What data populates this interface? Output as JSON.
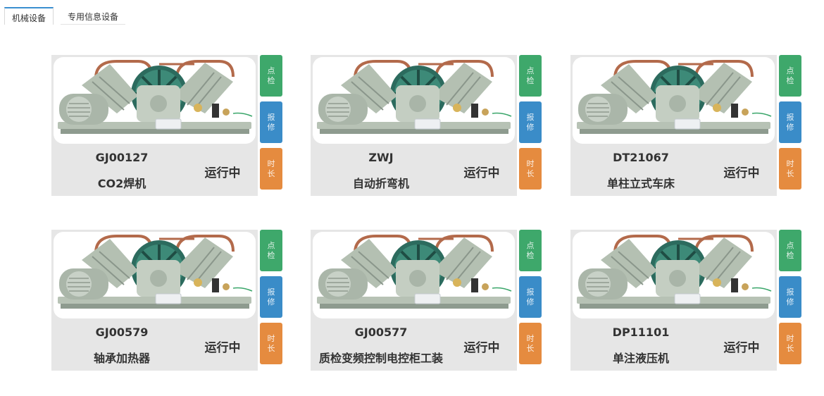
{
  "tabs": [
    {
      "label": "机械设备",
      "active": true
    },
    {
      "label": "专用信息设备",
      "active": false
    }
  ],
  "colors": {
    "inspect": "#3ea86b",
    "repair": "#3a8cc8",
    "duration": "#e58b3f",
    "card_bg": "#e6e6e6"
  },
  "side_buttons": {
    "inspect": "点检",
    "repair": "报修",
    "duration": "时长"
  },
  "devices": [
    {
      "code": "GJ00127",
      "name": "CO2焊机",
      "status": "运行中",
      "image_icon": "compressor-photo"
    },
    {
      "code": "ZWJ",
      "name": "自动折弯机",
      "status": "运行中",
      "image_icon": "compressor-photo"
    },
    {
      "code": "DT21067",
      "name": "单柱立式车床",
      "status": "运行中",
      "image_icon": "compressor-photo"
    },
    {
      "code": "GJ00579",
      "name": "轴承加热器",
      "status": "运行中",
      "image_icon": "compressor-photo"
    },
    {
      "code": "GJ00577",
      "name": "质检变频控制电控柜工装",
      "status": "运行中",
      "image_icon": "compressor-photo"
    },
    {
      "code": "DP11101",
      "name": "单注液压机",
      "status": "运行中",
      "image_icon": "compressor-photo"
    }
  ]
}
